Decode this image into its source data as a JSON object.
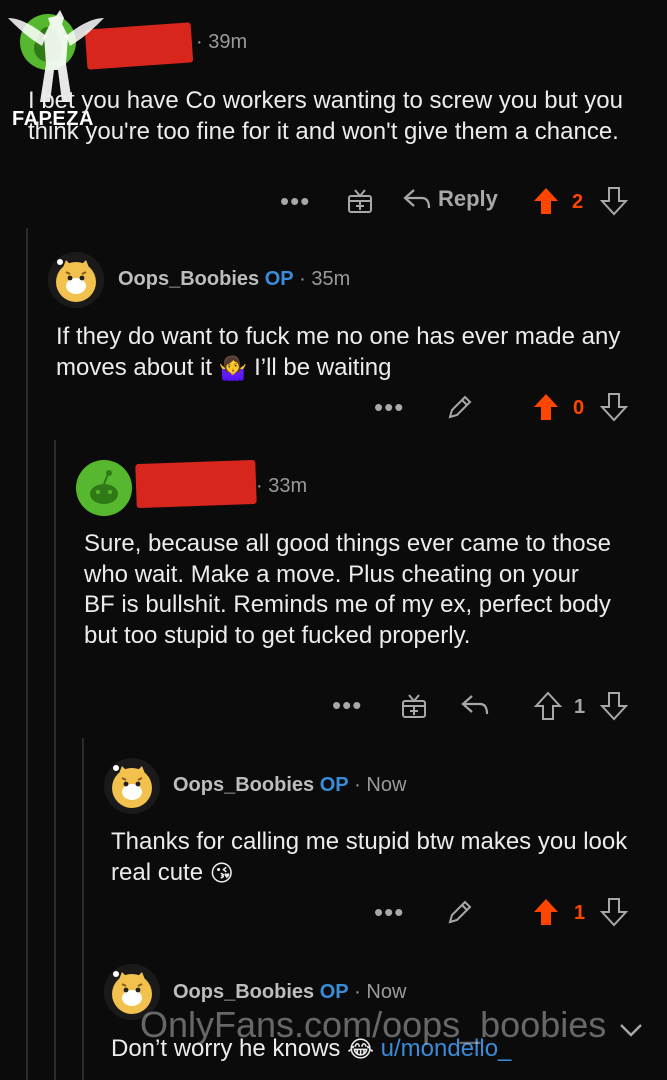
{
  "watermark": {
    "logo_text": "FAPEZA",
    "site_text": "OnlyFans.com/oops_boobies"
  },
  "comments": [
    {
      "time": "39m",
      "text": "I bet you have Co workers wanting to screw you but you think you're too fine for it and won't give them a chance.",
      "actions": {
        "more": "•••",
        "reply_label": "Reply"
      },
      "votes": {
        "score": "2",
        "upvoted": true
      }
    },
    {
      "username": "Oops_Boobies",
      "op_badge": "OP",
      "time": "35m",
      "text_before": "If they do want to fuck me no one has ever made any moves about it",
      "emoji": "🤷‍♀️",
      "text_after": "I’ll be waiting",
      "actions": {
        "more": "•••"
      },
      "votes": {
        "score": "0",
        "upvoted": true
      }
    },
    {
      "time": "33m",
      "text": "Sure, because all good things ever came to those who wait. Make a move. Plus cheating on your BF is bullshit. Reminds me of my ex, perfect body but too stupid to get fucked properly.",
      "actions": {
        "more": "•••"
      },
      "votes": {
        "score": "1",
        "upvoted": false
      }
    },
    {
      "username": "Oops_Boobies",
      "op_badge": "OP",
      "time": "Now",
      "text": "Thanks for calling me stupid btw makes you look real cute",
      "emoji": "😘",
      "actions": {
        "more": "•••"
      },
      "votes": {
        "score": "1",
        "upvoted": true
      }
    },
    {
      "username": "Oops_Boobies",
      "op_badge": "OP",
      "time": "Now",
      "text": "Don’t worry he knows",
      "emoji": "😂",
      "mention": "u/mondello_"
    }
  ],
  "colors": {
    "upvote": "#ff4500",
    "op": "#3a8bd8",
    "redaction": "#d9261c"
  }
}
